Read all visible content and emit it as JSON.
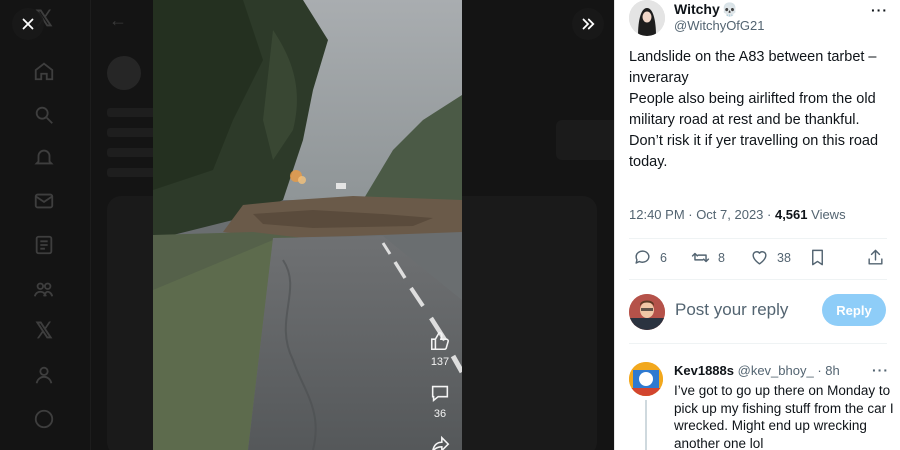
{
  "modal": {
    "close_icon": "close-icon",
    "expand_icon": "chevrons-right-icon"
  },
  "video": {
    "like_count": "137",
    "comment_count": "36",
    "icons": [
      "thumbs-up-icon",
      "comment-bubble-icon",
      "share-arrow-icon"
    ]
  },
  "tweet": {
    "author_name": "Witchy",
    "author_emoji": "💀",
    "author_handle": "@WitchyOfG21",
    "more": "···",
    "text_lines": [
      "Landslide on the A83 between tarbet – inveraray",
      "People also being airlifted from the old military road at rest and be thankful.",
      "Don’t risk it if yer travelling on this road today."
    ],
    "time": "12:40 PM · Oct 7, 2023 · ",
    "views_count": "4,561",
    "views_label": " Views",
    "replies": "6",
    "reposts": "8",
    "likes": "38"
  },
  "reply_box": {
    "placeholder": "Post your reply",
    "button": "Reply"
  },
  "comment": {
    "name": "Kev1888s",
    "handle": "@kev_bhoy_",
    "time": "· 8h",
    "more": "···",
    "text": "I’ve got to go up there on Monday to pick up my fishing stuff from the car I wrecked. Might end up wrecking another one lol"
  },
  "colors": {
    "accent": "#1d9bf0",
    "reply_button_disabled": "#8ecdf8",
    "text_primary": "#0f1419",
    "text_secondary": "#536471",
    "overlay": "#0b0b0b"
  }
}
